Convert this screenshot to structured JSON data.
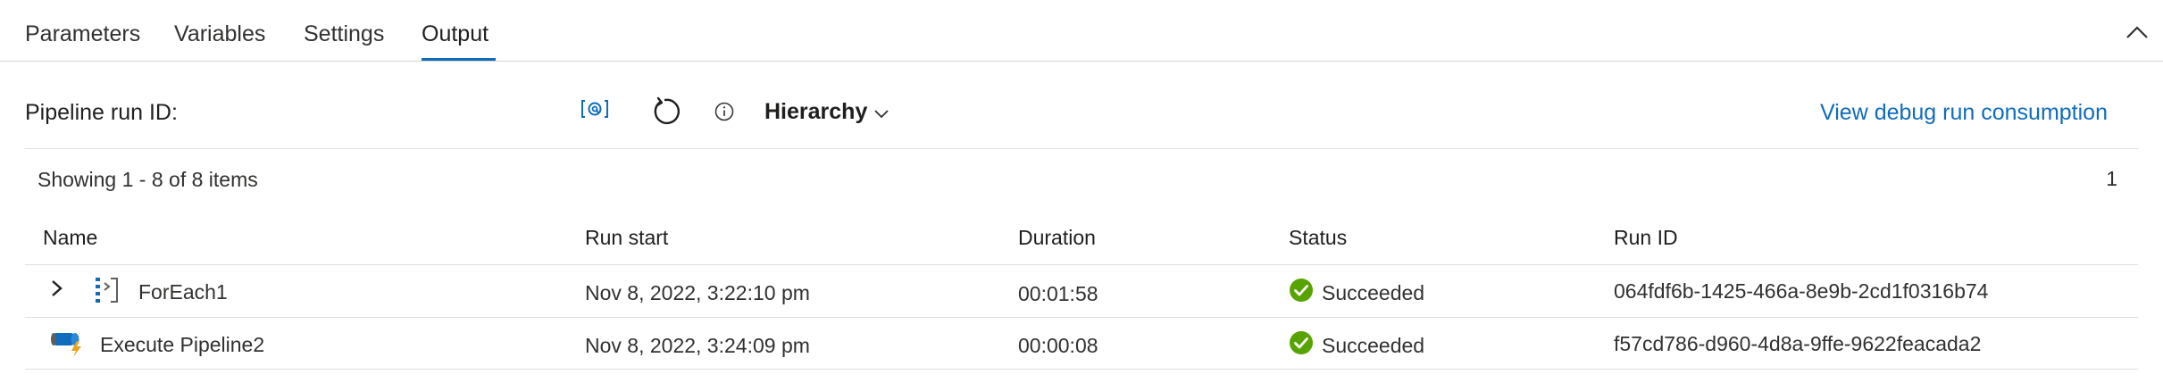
{
  "tabs": [
    {
      "label": "Parameters",
      "active": false
    },
    {
      "label": "Variables",
      "active": false
    },
    {
      "label": "Settings",
      "active": false
    },
    {
      "label": "Output",
      "active": true
    }
  ],
  "toolbar": {
    "run_id_label": "Pipeline run ID:",
    "copy_icon": "copy-run-id-icon",
    "refresh_icon": "refresh-icon",
    "info_icon": "info-icon",
    "view_mode": "Hierarchy",
    "debug_link": "View debug run consumption"
  },
  "summary": {
    "count_text": "Showing 1 - 8 of 8 items",
    "page": "1"
  },
  "table": {
    "columns": [
      "Name",
      "Run start",
      "Duration",
      "Status",
      "Run ID"
    ],
    "rows": [
      {
        "name": "ForEach1",
        "icon": "foreach-activity-icon",
        "expandable": true,
        "run_start": "Nov 8, 2022, 3:22:10 pm",
        "duration": "00:01:58",
        "status": "Succeeded",
        "run_id": "064fdf6b-1425-466a-8e9b-2cd1f0316b74"
      },
      {
        "name": "Execute Pipeline2",
        "icon": "execute-pipeline-icon",
        "expandable": false,
        "run_start": "Nov 8, 2022, 3:24:09 pm",
        "duration": "00:00:08",
        "status": "Succeeded",
        "run_id": "f57cd786-d960-4d8a-9ffe-9622feacada2"
      }
    ]
  },
  "colors": {
    "accent": "#0f6cbd",
    "success": "#57a300",
    "divider": "#e1dfdd"
  }
}
